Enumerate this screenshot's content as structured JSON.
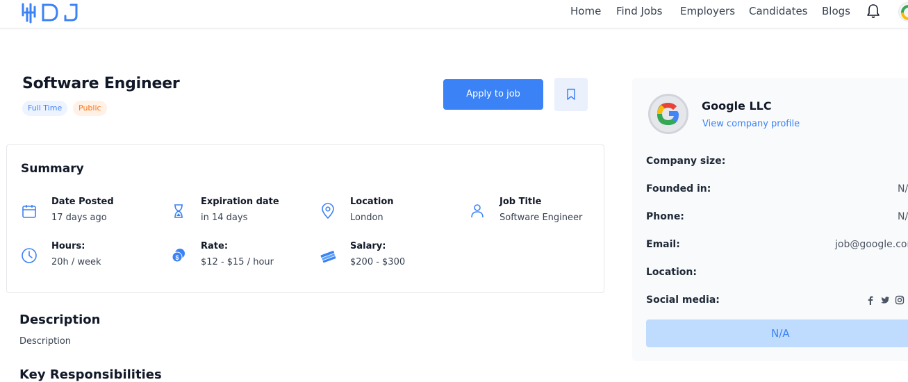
{
  "header": {
    "nav": [
      {
        "label": "Home"
      },
      {
        "label": "Find Jobs"
      },
      {
        "label": "Employers"
      },
      {
        "label": "Candidates"
      },
      {
        "label": "Blogs"
      }
    ]
  },
  "job": {
    "title": "Software Engineer",
    "tags": [
      "Full Time",
      "Public"
    ],
    "apply_label": "Apply to job"
  },
  "summary": {
    "title": "Summary",
    "items": [
      {
        "label": "Date Posted",
        "value": "17 days ago",
        "icon": "calendar-icon"
      },
      {
        "label": "Expiration date",
        "value": "in 14 days",
        "icon": "hourglass-icon"
      },
      {
        "label": "Location",
        "value": "London",
        "icon": "map-pin-icon"
      },
      {
        "label": "Job Title",
        "value": "Software Engineer",
        "icon": "user-icon"
      },
      {
        "label": "Hours:",
        "value": "20h / week",
        "icon": "clock-icon"
      },
      {
        "label": "Rate:",
        "value": "$12 - $15 / hour",
        "icon": "coins-icon"
      },
      {
        "label": "Salary:",
        "value": "$200 - $300",
        "icon": "money-icon"
      }
    ]
  },
  "description": {
    "title": "Description",
    "text": "Description"
  },
  "responsibilities": {
    "title": "Key Responsibilities"
  },
  "company": {
    "name": "Google LLC",
    "profile_link": "View company profile",
    "fields": [
      {
        "label": "Company size:",
        "value": ""
      },
      {
        "label": "Founded in:",
        "value": "N/A"
      },
      {
        "label": "Phone:",
        "value": "N/A"
      },
      {
        "label": "Email:",
        "value": "job@google.com"
      },
      {
        "label": "Location:",
        "value": ""
      },
      {
        "label": "Social media:",
        "value": ""
      }
    ],
    "button_label": "N/A"
  },
  "colors": {
    "primary": "#3b82f6",
    "primary_light": "#bfdbfe",
    "tag_blue_bg": "#eef4ff",
    "tag_orange": "#f97316"
  }
}
